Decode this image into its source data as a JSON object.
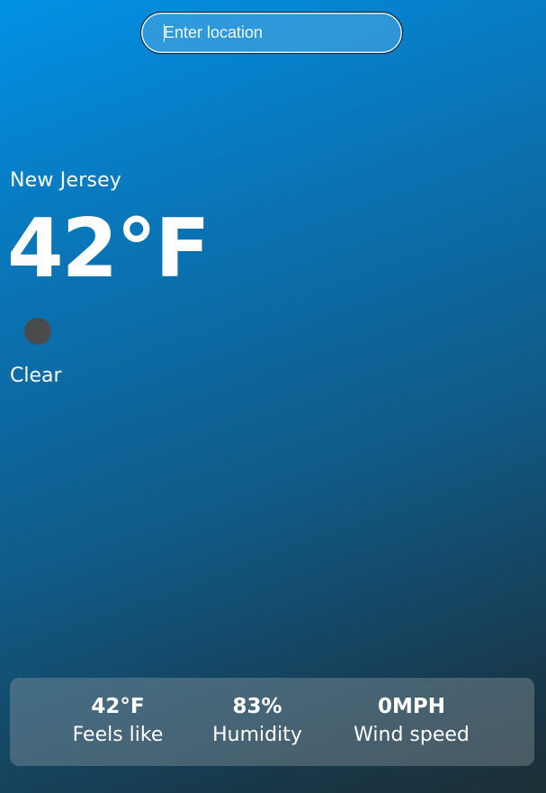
{
  "search": {
    "placeholder": "Enter location",
    "value": ""
  },
  "current": {
    "location": "New Jersey",
    "temperature": "42°F",
    "condition": "Clear",
    "icon": "weather-condition-icon"
  },
  "stats": {
    "feels_like": {
      "value": "42°F",
      "label": "Feels like"
    },
    "humidity": {
      "value": "83%",
      "label": "Humidity"
    },
    "wind_speed": {
      "value": "0MPH",
      "label": "Wind speed"
    }
  },
  "colors": {
    "gradient_top": "#0291e5",
    "gradient_bottom": "#1c2f36",
    "text": "#ffffff",
    "icon_fill": "#4a4b4d"
  }
}
